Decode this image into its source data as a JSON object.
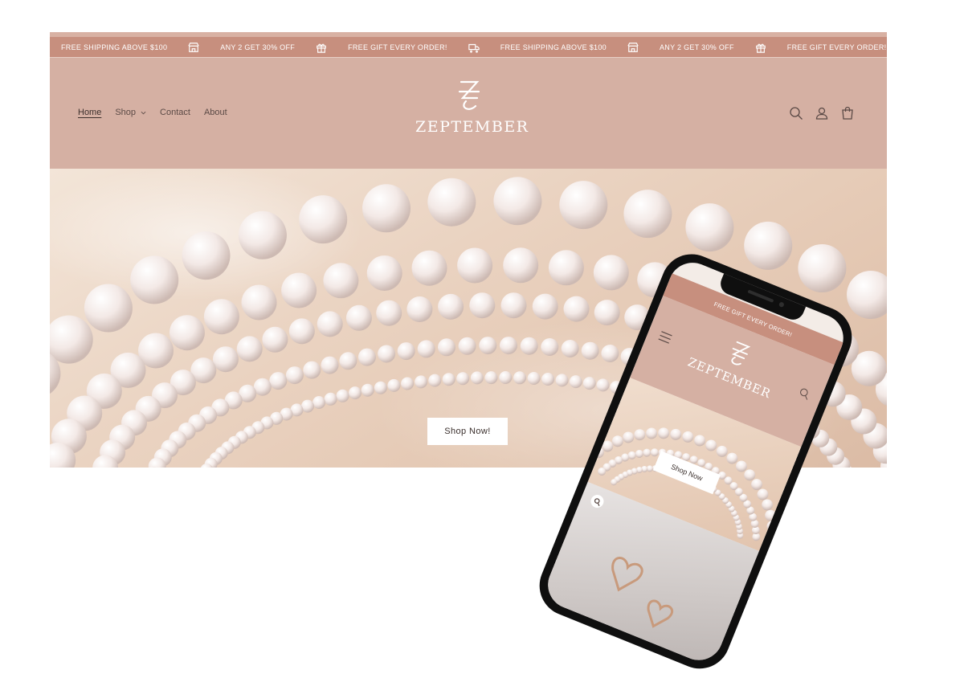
{
  "announcement": {
    "items": [
      {
        "text": "FREE SHIPPING ABOVE $100",
        "icon": "store-icon"
      },
      {
        "text": "ANY 2 GET 30% OFF",
        "icon": "gift-icon"
      },
      {
        "text": "FREE GIFT EVERY ORDER!",
        "icon": "truck-icon"
      },
      {
        "text": "FREE SHIPPING ABOVE $100",
        "icon": "store-icon"
      },
      {
        "text": "ANY 2 GET 30% OFF",
        "icon": "gift-icon"
      },
      {
        "text": "FREE GIFT EVERY ORDER!",
        "icon": ""
      }
    ]
  },
  "nav": {
    "home": "Home",
    "shop": "Shop",
    "contact": "Contact",
    "about": "About"
  },
  "brand": {
    "name": "ZEPTEMBER"
  },
  "hero": {
    "cta": "Shop Now!"
  },
  "mobile": {
    "announcement": "FREE GIFT EVERY ORDER!",
    "brand": "ZEPTEMBER",
    "cta": "Shop Now"
  },
  "colors": {
    "announce_bg": "#c78f7e",
    "header_bg": "#d5b0a3",
    "text": "#5b4a46"
  }
}
